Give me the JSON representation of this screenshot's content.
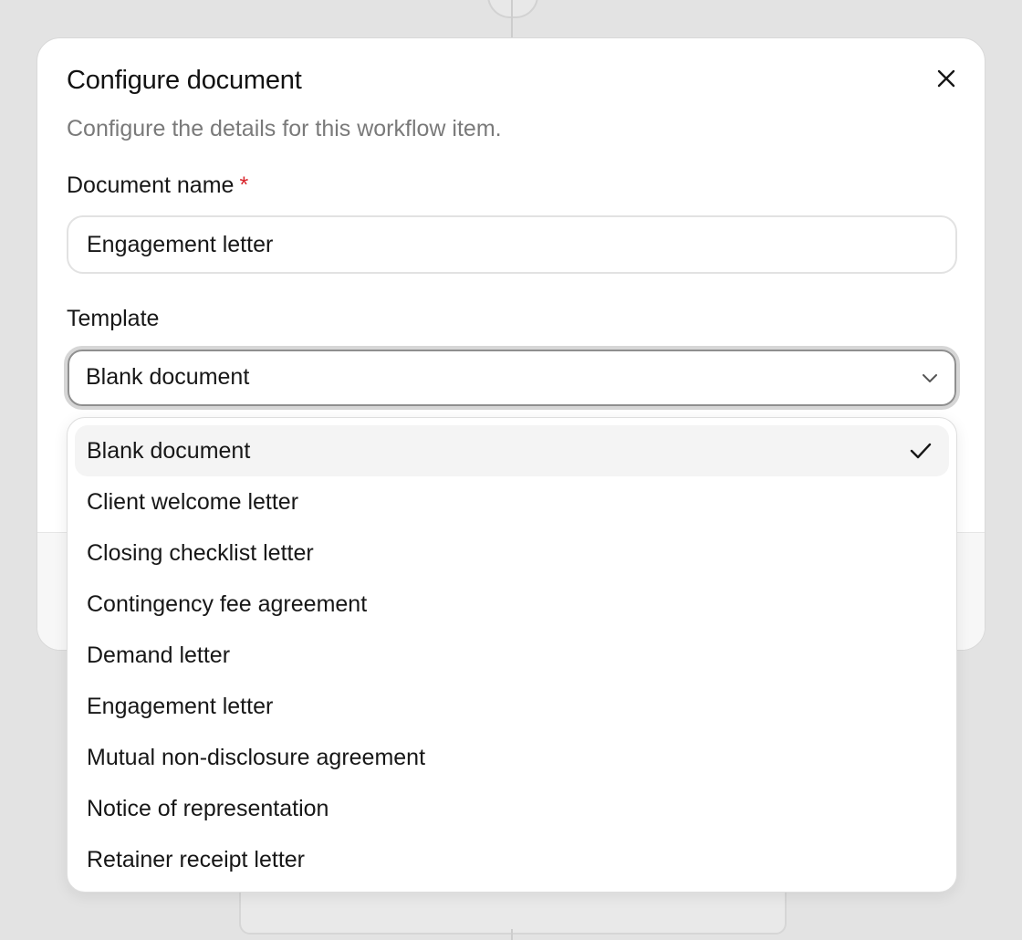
{
  "dialog": {
    "title": "Configure document",
    "description": "Configure the details for this workflow item.",
    "close_icon": "close-icon"
  },
  "document_name": {
    "label": "Document name",
    "required_mark": "*",
    "value": "Engagement letter"
  },
  "template": {
    "label": "Template",
    "selected": "Blank document",
    "options": [
      "Blank document",
      "Client welcome letter",
      "Closing checklist letter",
      "Contingency fee agreement",
      "Demand letter",
      "Engagement letter",
      "Mutual non-disclosure agreement",
      "Notice of representation",
      "Retainer receipt letter"
    ]
  },
  "colors": {
    "required": "#d8232a",
    "backdrop": "#e3e3e3",
    "selected_option_bg": "#f4f4f4",
    "muted_text": "#7a7a7a"
  },
  "icons": {
    "select": "chevron-down-icon",
    "selected_option": "check-icon"
  }
}
